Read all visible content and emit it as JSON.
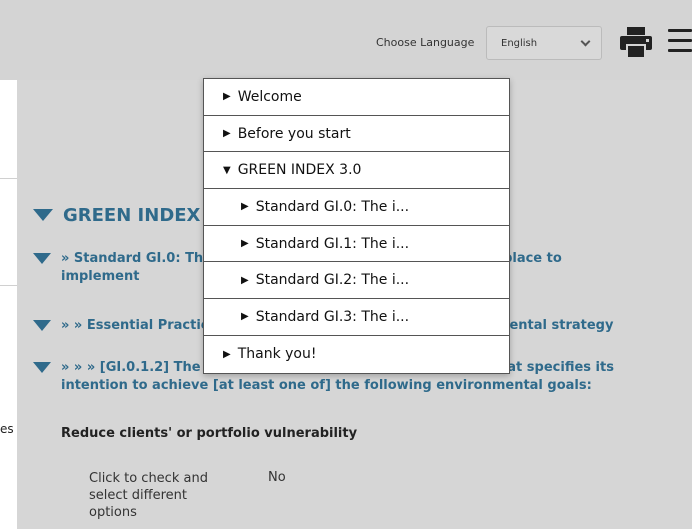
{
  "header": {
    "language_label": "Choose Language",
    "language_selected": "English",
    "print_icon": "printer-icon",
    "menu_icon": "hamburger-menu-icon"
  },
  "side_text": "es",
  "content": {
    "heading_main": "GREEN INDEX 3.0",
    "heading_standard": "» Standard GI.0: The institution has policies and systems in place to implement",
    "heading_practice": "» » Essential Practice GI.0.1: The institution has an environmental strategy",
    "heading_indicator": "» » » [GI.0.1.2] The institution has a documented strategy that specifies its intention to achieve [at least one of] the following environmental goals:",
    "goal_title": "Reduce clients' or portfolio vulnerability",
    "click_text": "Click to check and select different options",
    "answer": "No"
  },
  "toc": {
    "items": [
      {
        "arrow": "▶",
        "label": "Welcome"
      },
      {
        "arrow": "▶",
        "label": "Before you start"
      },
      {
        "arrow": "▼",
        "label": "GREEN INDEX 3.0"
      },
      {
        "arrow": "▶",
        "label": "Standard GI.0: The i..."
      },
      {
        "arrow": "▶",
        "label": "Standard GI.1: The i..."
      },
      {
        "arrow": "▶",
        "label": "Standard GI.2: The i..."
      },
      {
        "arrow": "▶",
        "label": "Standard GI.3: The i..."
      },
      {
        "arrow": "▶",
        "label": "Thank you!"
      }
    ]
  }
}
